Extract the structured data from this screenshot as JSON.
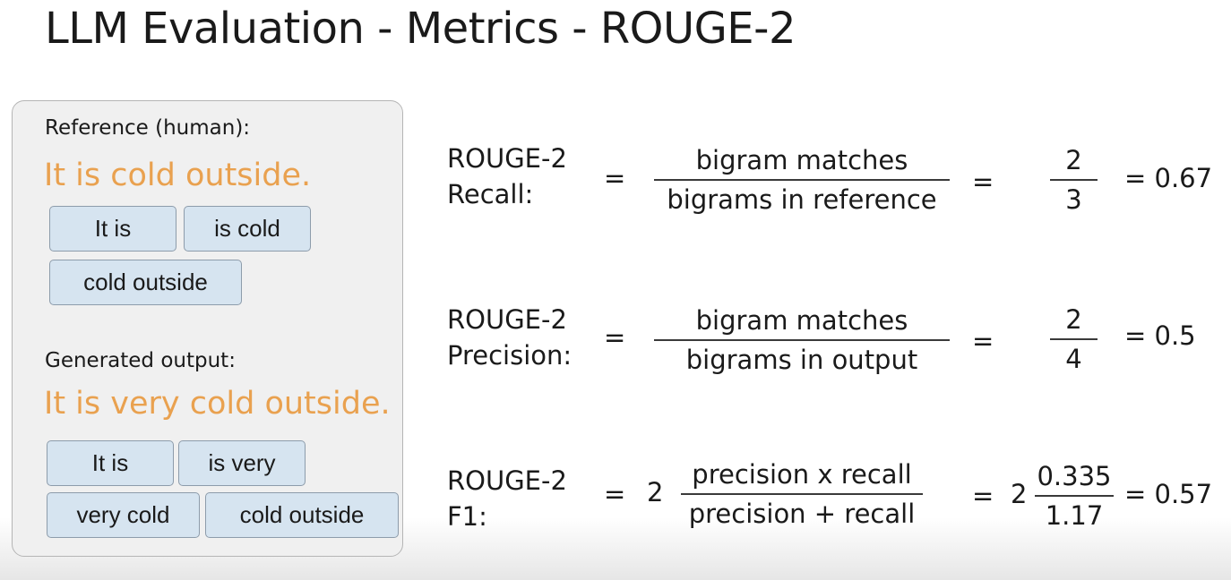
{
  "title": "LLM Evaluation - Metrics - ROUGE-2",
  "reference": {
    "label": "Reference (human):",
    "sentence": "It is cold outside.",
    "bigrams": [
      "It is",
      "is cold",
      "cold outside"
    ]
  },
  "generated": {
    "label": "Generated output:",
    "sentence": "It is very cold outside.",
    "bigrams": [
      "It is",
      "is very",
      "very cold",
      "cold outside"
    ]
  },
  "colors": {
    "sentence_accent": "#e9a14f",
    "chip_fill": "#d6e4f0",
    "panel_fill": "#f0f0f0"
  },
  "formulas": {
    "recall": {
      "label_line1": "ROUGE-2",
      "label_line2": "Recall:",
      "eq1": "=",
      "numerator": "bigram matches",
      "denominator": "bigrams in reference",
      "eq2": "=",
      "value_num": "2",
      "value_den": "3",
      "result": "= 0.67"
    },
    "precision": {
      "label_line1": "ROUGE-2",
      "label_line2": "Precision:",
      "eq1": "=",
      "numerator": "bigram matches",
      "denominator": "bigrams in output",
      "eq2": "=",
      "value_num": "2",
      "value_den": "4",
      "result": "= 0.5"
    },
    "f1": {
      "label_line1": "ROUGE-2",
      "label_line2": "F1:",
      "eq1": "=",
      "coef": "2",
      "numerator": "precision x recall",
      "denominator": "precision + recall",
      "eq2": "=",
      "value_coef": "2",
      "value_num": "0.335",
      "value_den": "1.17",
      "result": "= 0.57"
    }
  }
}
